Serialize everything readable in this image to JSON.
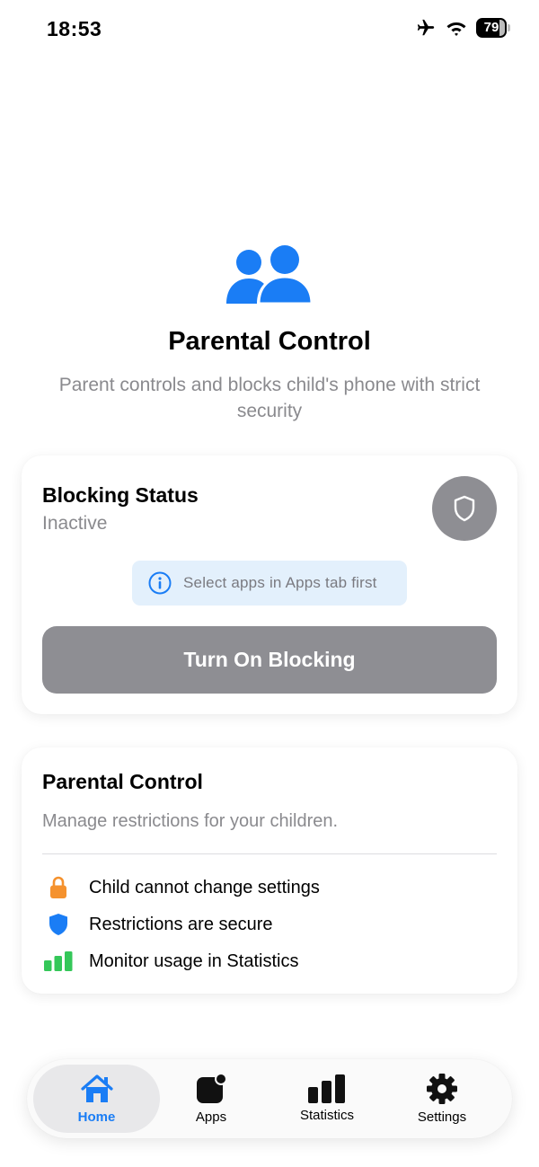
{
  "status_bar": {
    "time": "18:53",
    "battery": "79",
    "battery_level": 0.79
  },
  "hero": {
    "icon": "person-2-icon",
    "title": "Parental Control",
    "subtitle": "Parent controls and blocks child's phone with strict security"
  },
  "blocking_card": {
    "title": "Blocking Status",
    "state": "Inactive",
    "status_icon": "shield-icon",
    "hint": "Select apps in Apps tab first",
    "button_label": "Turn On Blocking"
  },
  "parental_card": {
    "title": "Parental Control",
    "description": "Manage restrictions for your children.",
    "items": [
      {
        "icon": "lock-icon",
        "label": "Child cannot change settings",
        "color": "#f5922e"
      },
      {
        "icon": "shield-icon",
        "label": "Restrictions are secure",
        "color": "#1a7df5"
      },
      {
        "icon": "chart-bar-icon",
        "label": "Monitor usage in Statistics",
        "color": "#34c759"
      }
    ]
  },
  "tabbar": {
    "tabs": [
      {
        "icon": "house-icon",
        "label": "Home",
        "active": true
      },
      {
        "icon": "app-badge-icon",
        "label": "Apps",
        "active": false
      },
      {
        "icon": "chart-bar-icon",
        "label": "Statistics",
        "active": false
      },
      {
        "icon": "gear-icon",
        "label": "Settings",
        "active": false
      }
    ]
  },
  "colors": {
    "accent": "#1a7df5",
    "inactive_gray": "#8e8e93",
    "hint_bg": "#e3f0fc"
  }
}
